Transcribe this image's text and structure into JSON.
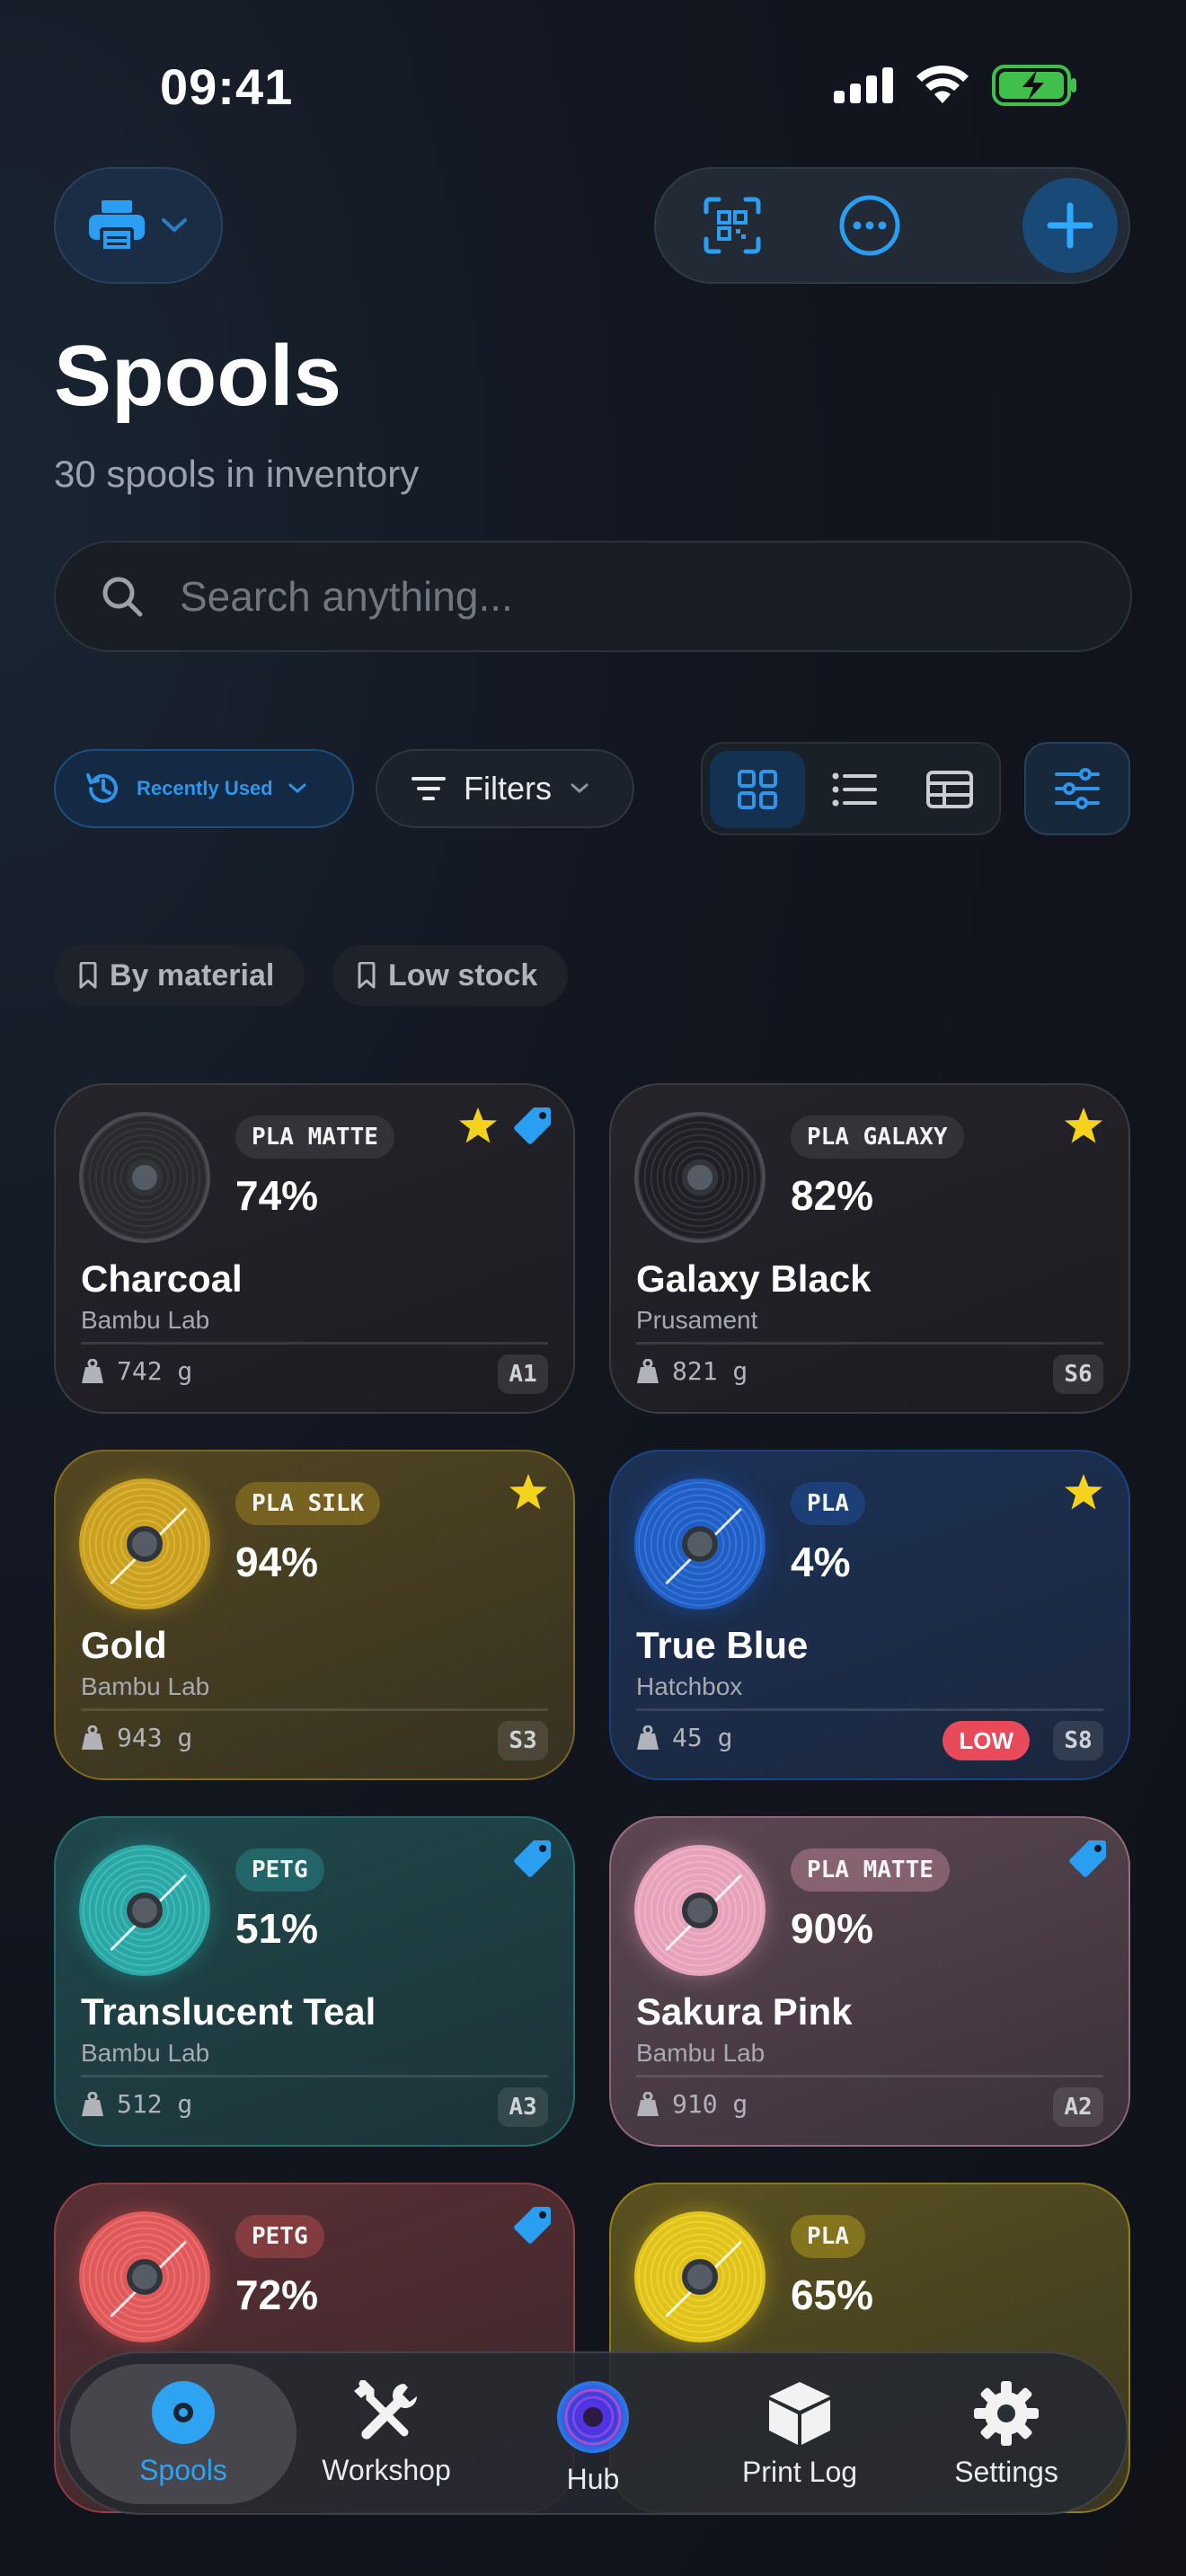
{
  "status_bar": {
    "time": "09:41"
  },
  "header": {
    "title": "Spools",
    "subtitle": "30 spools in inventory"
  },
  "search": {
    "placeholder": "Search anything..."
  },
  "filters": {
    "sort_label": "Recently Used",
    "filters_label": "Filters",
    "view_modes": [
      "grid",
      "list",
      "table"
    ],
    "active_view": "grid"
  },
  "saved_filters": [
    "By material",
    "Low stock"
  ],
  "spools": [
    {
      "material": "PLA MATTE",
      "percent": "74%",
      "name": "Charcoal",
      "brand": "Bambu Lab",
      "weight": "742 g",
      "location": "A1",
      "favorite": true,
      "tagged": true,
      "low": false,
      "color": "#2a2a2d"
    },
    {
      "material": "PLA GALAXY",
      "percent": "82%",
      "name": "Galaxy Black",
      "brand": "Prusament",
      "weight": "821 g",
      "location": "S6",
      "favorite": true,
      "tagged": false,
      "low": false,
      "color": "#1f1f25"
    },
    {
      "material": "PLA SILK",
      "percent": "94%",
      "name": "Gold",
      "brand": "Bambu Lab",
      "weight": "943 g",
      "location": "S3",
      "favorite": true,
      "tagged": false,
      "low": false,
      "color": "#c9a020"
    },
    {
      "material": "PLA",
      "percent": "4%",
      "name": "True Blue",
      "brand": "Hatchbox",
      "weight": "45 g",
      "location": "S8",
      "favorite": true,
      "tagged": false,
      "low": true,
      "low_label": "LOW",
      "color": "#1f5ec4"
    },
    {
      "material": "PETG",
      "percent": "51%",
      "name": "Translucent Teal",
      "brand": "Bambu Lab",
      "weight": "512 g",
      "location": "A3",
      "favorite": false,
      "tagged": true,
      "low": false,
      "color": "#2aa7a5"
    },
    {
      "material": "PLA MATTE",
      "percent": "90%",
      "name": "Sakura Pink",
      "brand": "Bambu Lab",
      "weight": "910 g",
      "location": "A2",
      "favorite": false,
      "tagged": true,
      "low": false,
      "color": "#e7a1b8"
    },
    {
      "material": "PETG",
      "percent": "72%",
      "favorite": false,
      "tagged": true,
      "color": "#e0595a"
    },
    {
      "material": "PLA",
      "percent": "65%",
      "favorite": false,
      "tagged": false,
      "color": "#e1c21a"
    }
  ],
  "tab_bar": {
    "tabs": [
      "Spools",
      "Workshop",
      "Hub",
      "Print Log",
      "Settings"
    ],
    "active": "Spools"
  },
  "colors": {
    "accent": "#2ea3f2",
    "low": "#e84a5a",
    "star": "#f5d31c"
  }
}
